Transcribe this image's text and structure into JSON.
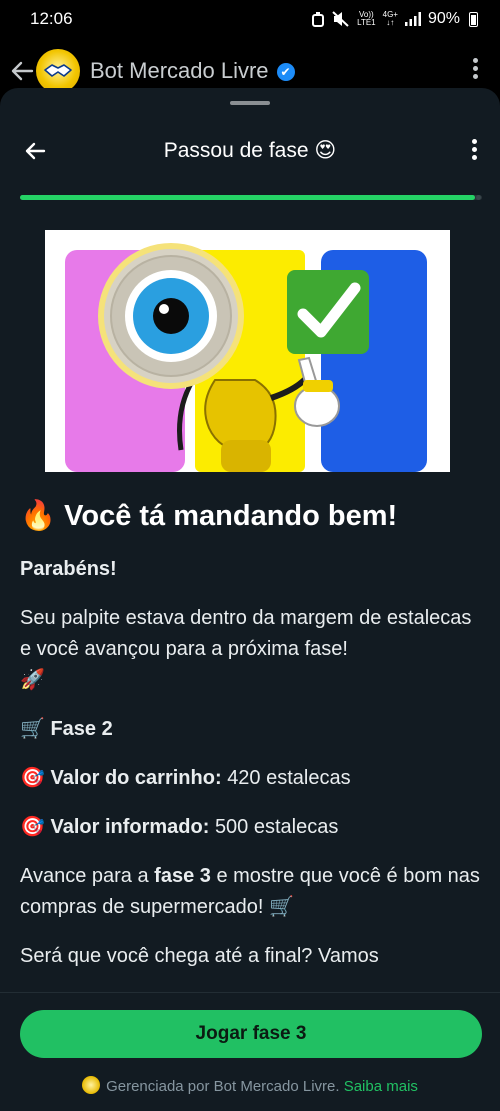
{
  "status_bar": {
    "time": "12:06",
    "volte_top": "Vo))",
    "volte_bottom": "LTE1",
    "network_top": "4G+",
    "network_bottom": "↓↑",
    "battery": "90%"
  },
  "chat": {
    "name": "Bot Mercado Livre",
    "verified": "✔",
    "avatar_icon": "handshake-icon"
  },
  "sheet": {
    "title": "Passou de fase 😍",
    "progress": 0.985
  },
  "hero": {
    "check_emoji": "✔",
    "colors": {
      "pink": "#e77ae9",
      "yellow": "#fcec00",
      "blue": "#1e5ee6",
      "check_green": "#3fa832"
    }
  },
  "message": {
    "headline_emoji": "🔥",
    "headline": "Você tá mandando bem!",
    "congrats": "Parabéns!",
    "intro": "Seu palpite estava dentro da margem de estalecas e você avançou para a próxima fase!",
    "rocket": "🚀",
    "phase_emoji": "🛒",
    "phase": "Fase 2",
    "cart_emoji": "🎯",
    "cart_label": "Valor do carrinho:",
    "cart_value": "420 estalecas",
    "informed_emoji": "🎯",
    "informed_label": "Valor informado:",
    "informed_value": "500 estalecas",
    "advance_pre": "Avance para a ",
    "advance_bold": "fase 3",
    "advance_post": " e mostre que você é bom nas compras de supermercado! 🛒",
    "question": "Será que você chega até a final? Vamos"
  },
  "cta": {
    "label": "Jogar fase 3"
  },
  "footer": {
    "text": "Gerenciada por Bot Mercado Livre.",
    "link": "Saiba mais"
  },
  "colors": {
    "accent": "#21c063",
    "background": "#121b22",
    "verified": "#1d8cf8"
  }
}
